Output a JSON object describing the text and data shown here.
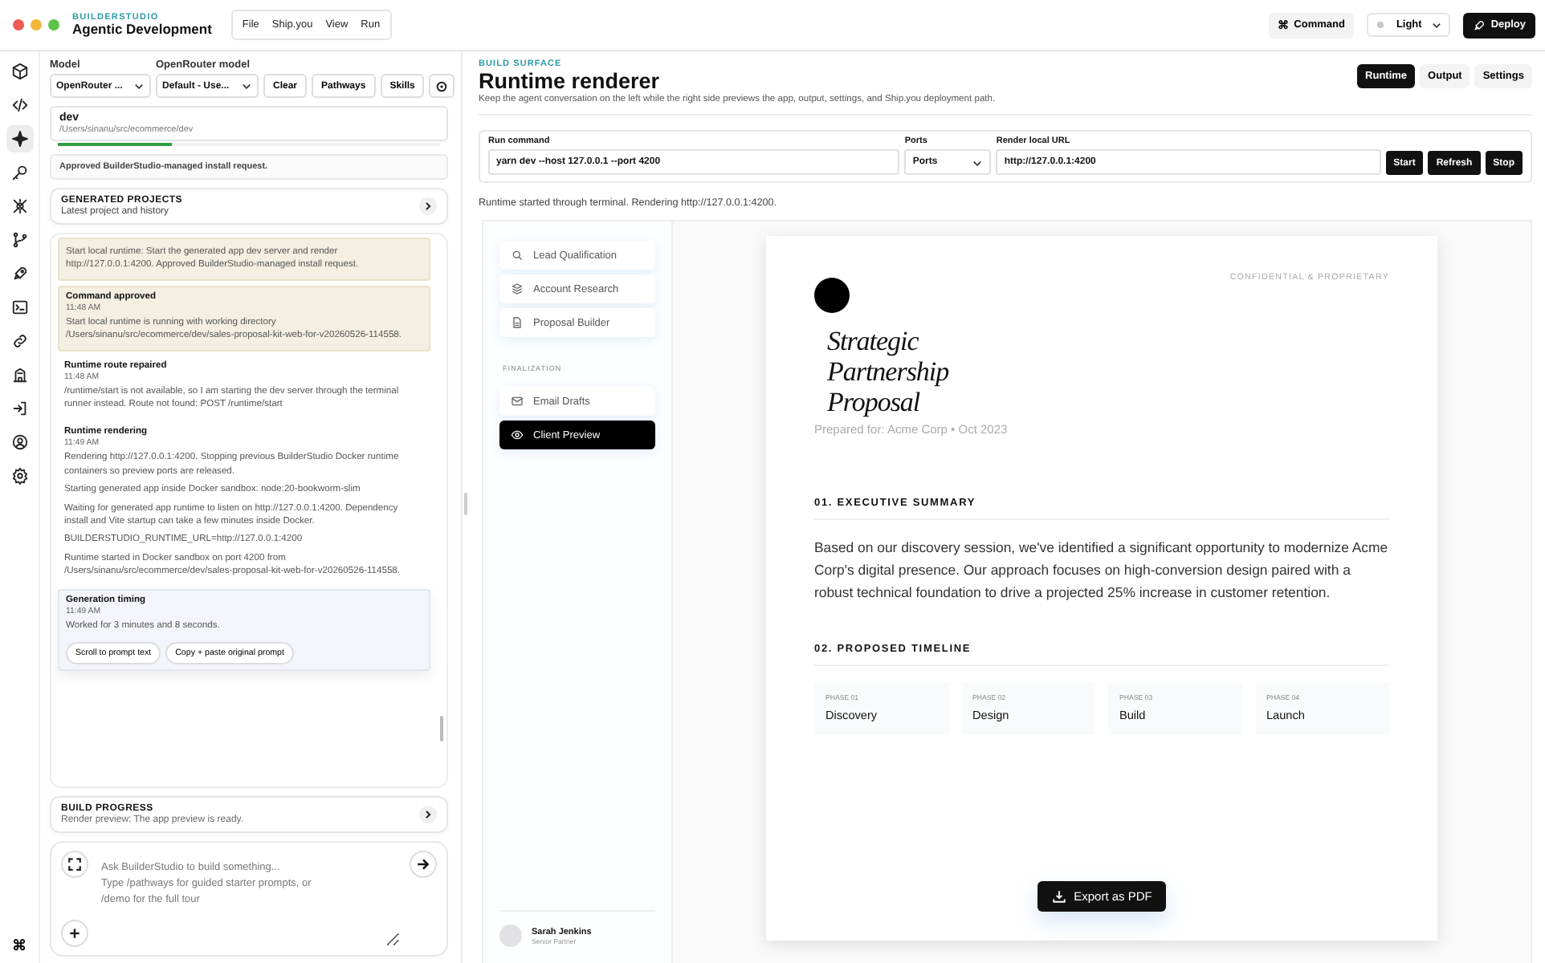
{
  "app": {
    "brand": "BUILDERSTUDIO",
    "title": "Agentic Development"
  },
  "menu": [
    "File",
    "Ship.you",
    "View",
    "Run"
  ],
  "toolbar": {
    "command_glyph": "⌘",
    "command": "Command",
    "theme": "Light",
    "deploy": "Deploy"
  },
  "rail": [
    {
      "kind": "cube",
      "selected": false
    },
    {
      "kind": "code",
      "selected": false
    },
    {
      "kind": "sparkle",
      "selected": true
    },
    {
      "kind": "key",
      "selected": false
    },
    {
      "kind": "crossed",
      "selected": false
    },
    {
      "kind": "branch",
      "selected": false
    },
    {
      "kind": "rocket",
      "selected": false
    },
    {
      "kind": "terminal",
      "selected": false
    },
    {
      "kind": "link",
      "selected": false
    },
    {
      "kind": "building",
      "selected": false
    },
    {
      "kind": "login",
      "selected": false
    },
    {
      "kind": "user",
      "selected": false
    },
    {
      "kind": "gear",
      "selected": false
    }
  ],
  "rail_bottom_glyph": "⌘",
  "agent": {
    "model_label": "Model",
    "model_value": "OpenRouter ...",
    "router_label": "OpenRouter model",
    "router_value": "Default - Use...",
    "buttons": [
      "Clear",
      "Pathways",
      "Skills"
    ],
    "workspace": {
      "name": "dev",
      "path": "/Users/sinanu/src/ecommerce/dev",
      "level": 0.3
    },
    "notice": "Approved BuilderStudio-managed install request.",
    "projects": {
      "title": "GENERATED PROJECTS",
      "subtitle": "Latest project and history"
    },
    "log": [
      {
        "kind": "approval",
        "paragraphs": [
          "Start local runtime: Start the generated app dev server and render http://127.0.0.1:4200. Approved BuilderStudio-managed install request."
        ]
      },
      {
        "kind": "approval",
        "title": "Command approved",
        "time": "11:48 AM",
        "paragraphs": [
          "Start local runtime is running with working directory /Users/sinanu/src/ecommerce/dev/sales-proposal-kit-web-for-v20260526-114558."
        ]
      },
      {
        "kind": "event",
        "title": "Runtime route repaired",
        "time": "11:48 AM",
        "paragraphs": [
          "/runtime/start is not available, so I am starting the dev server through the terminal runner instead. Route not found: POST /runtime/start"
        ]
      },
      {
        "kind": "event",
        "title": "Runtime rendering",
        "time": "11:49 AM",
        "paragraphs": [
          "Rendering http://127.0.0.1:4200. Stopping previous BuilderStudio Docker runtime containers so preview ports are released.",
          "Starting generated app inside Docker sandbox: node:20-bookworm-slim",
          "Waiting for generated app runtime to listen on http://127.0.0.1:4200. Dependency install and Vite startup can take a few minutes inside Docker.",
          "BUILDERSTUDIO_RUNTIME_URL=http://127.0.0.1:4200",
          "Runtime started in Docker sandbox on port 4200 from /Users/sinanu/src/ecommerce/dev/sales-proposal-kit-web-for-v20260526-114558."
        ]
      },
      {
        "kind": "timing",
        "title": "Generation timing",
        "time": "11:49 AM",
        "paragraphs": [
          "Worked for 3 minutes and 8 seconds."
        ],
        "actions": [
          "Scroll to prompt text",
          "Copy + paste original prompt"
        ]
      }
    ],
    "build_progress": {
      "title": "BUILD PROGRESS",
      "subtitle": "Render preview: The app preview is ready."
    },
    "composer": {
      "placeholder": "Ask BuilderStudio to build something...\nType /pathways for guided starter prompts, or\n/demo for the full tour"
    }
  },
  "surface": {
    "eyebrow": "BUILD SURFACE",
    "title": "Runtime renderer",
    "description": "Keep the agent conversation on the left while the right side previews the app, output, settings, and Ship.you deployment path.",
    "tabs": [
      {
        "label": "Runtime",
        "selected": true
      },
      {
        "label": "Output",
        "selected": false
      },
      {
        "label": "Settings",
        "selected": false
      }
    ]
  },
  "run": {
    "command_label": "Run command",
    "command": "yarn dev --host 127.0.0.1 --port 4200",
    "ports_label": "Ports",
    "ports": "Ports",
    "url_label": "Render local URL",
    "url": "http://127.0.0.1:4200",
    "actions": [
      "Start",
      "Refresh",
      "Stop"
    ]
  },
  "status": "Runtime started through terminal. Rendering http://127.0.0.1:4200.",
  "preview": {
    "nav": [
      {
        "kind": "search",
        "label": "Lead Qualification",
        "selected": false
      },
      {
        "kind": "layers",
        "label": "Account Research",
        "selected": false
      },
      {
        "kind": "document",
        "label": "Proposal Builder",
        "selected": false
      },
      {
        "kind": "section",
        "label": "FINALIZATION"
      },
      {
        "kind": "mail",
        "label": "Email Drafts",
        "selected": false
      },
      {
        "kind": "eye",
        "label": "Client Preview",
        "selected": true
      }
    ],
    "user": {
      "name": "Sarah Jenkins",
      "role": "Senior Partner"
    },
    "document": {
      "tag": "CONFIDENTIAL & PROPRIETARY",
      "title": [
        "Strategic",
        "Partnership",
        "Proposal"
      ],
      "prepared": "Prepared for: Acme Corp • Oct 2023",
      "summary_heading": "01. EXECUTIVE SUMMARY",
      "summary": "Based on our discovery session, we've identified a significant opportunity to modernize Acme Corp's digital presence. Our approach focuses on high-conversion design paired with a robust technical foundation to drive a projected 25% increase in customer retention.",
      "timeline_heading": "02. PROPOSED TIMELINE",
      "phases": [
        {
          "label": "PHASE 01",
          "name": "Discovery"
        },
        {
          "label": "PHASE 02",
          "name": "Design"
        },
        {
          "label": "PHASE 03",
          "name": "Build"
        },
        {
          "label": "PHASE 04",
          "name": "Launch"
        }
      ]
    },
    "export": "Export as PDF"
  }
}
